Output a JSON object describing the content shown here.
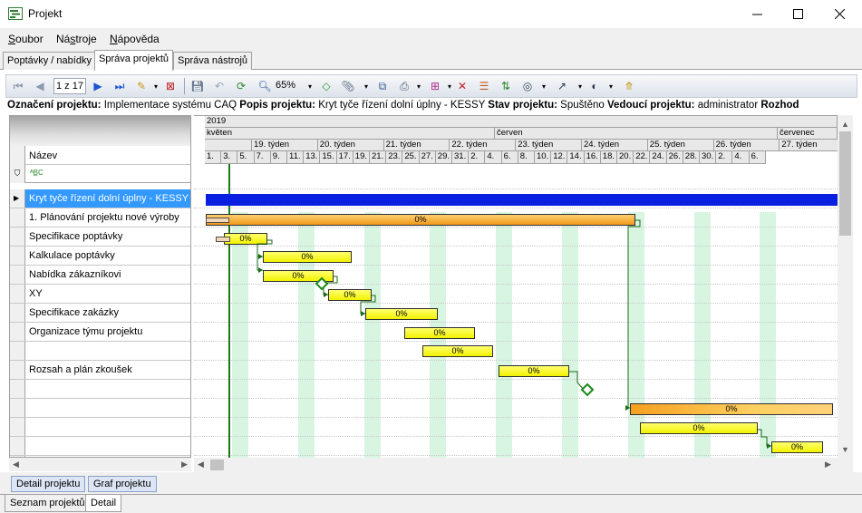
{
  "window": {
    "title": "Projekt",
    "minimize": "—",
    "maximize": "☐",
    "close": "✕"
  },
  "menu": [
    {
      "label": "Soubor",
      "u": "S",
      "rest": "oubor"
    },
    {
      "label": "Nástroje",
      "u": "s",
      "rest": "troje",
      "pre": "Ná"
    },
    {
      "label": "Nápověda",
      "u": "N",
      "rest": "ápověda"
    }
  ],
  "top_tabs": [
    "Poptávky / nabídky",
    "Správa projektů",
    "Správa nástrojů"
  ],
  "active_top_tab": "Správa projektů",
  "toolbar": {
    "pager": "1 z 17",
    "zoom": "65%"
  },
  "info": {
    "code_label": "Označení projektu:",
    "code_value": "Implementace systému CAQ",
    "desc_label": "Popis projektu:",
    "desc_value": "Kryt tyče řízení dolní úplny - KESSY",
    "state_label": "Stav projektu:",
    "state_value": "Spuštěno",
    "lead_label": "Vedoucí projektu:",
    "lead_value": "administrator",
    "more_label": "Rozhod"
  },
  "grid": {
    "column_name": "Název",
    "filter_icon": "filter-icon",
    "rows": [
      "Kryt tyče řízení dolní úplny - KESSY",
      "1. Plánování projektu nové výroby",
      "Specifikace poptávky",
      "Kalkulace poptávky",
      "Nabídka zákazníkovi",
      "XY",
      "Specifikace zakázky",
      "Organizace týmu projektu",
      "",
      "Rozsah a plán zkoušek",
      "",
      "",
      "",
      "",
      ""
    ]
  },
  "gantt": {
    "year": "2019",
    "months": [
      "květen",
      "červen",
      "červenec"
    ],
    "weeks": [
      "19. týden",
      "20. týden",
      "21. týden",
      "22. týden",
      "23. týden",
      "24. týden",
      "25. týden",
      "26. týden",
      "27. týden"
    ],
    "days": [
      "1.",
      "3.",
      "5.",
      "7.",
      "9.",
      "11.",
      "13.",
      "15.",
      "17.",
      "19.",
      "21.",
      "23.",
      "25.",
      "27.",
      "29.",
      "31.",
      "2.",
      "4.",
      "6.",
      "8.",
      "10.",
      "12.",
      "14.",
      "16.",
      "18.",
      "20.",
      "22.",
      "24.",
      "26.",
      "28.",
      "30.",
      "2.",
      "4.",
      "6."
    ],
    "bar_label": "0%"
  },
  "bottom_tabs": [
    "Detail projektu",
    "Graf projektu"
  ],
  "footer_tabs": [
    "Seznam projektů",
    "Detail"
  ],
  "active_footer_tab": "Detail"
}
